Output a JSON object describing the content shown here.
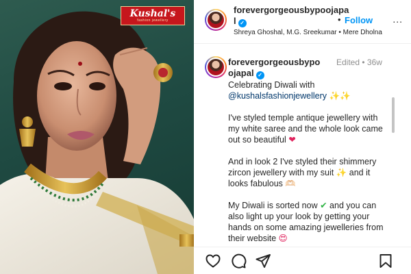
{
  "photo": {
    "brand_name": "Kushal's",
    "brand_tagline": "fashion jewellery"
  },
  "header": {
    "username": "forevergorgeousbypoojapal",
    "verified": true,
    "separator": "•",
    "follow_label": "Follow",
    "more_label": "...",
    "audio": "Shreya Ghoshal, M.G. Sreekumar • Mere Dholna"
  },
  "caption": {
    "username": "forevergorgeousbypoojapal",
    "edited_label": "Edited",
    "separator": "•",
    "age": "36w",
    "line1_text": "Celebrating Diwali with",
    "mention": "@kushalsfashionjewellery",
    "p2_text": "I've styled temple antique jewellery with my white saree and the whole look came out so beautiful",
    "p3_text_a": "And in look 2 I've styled their shimmery zircon jewellery with my suit",
    "p3_text_b": "and it looks fabulous",
    "p3_tail_emoji": "🫶🏻",
    "p4_text_a": "My Diwali is sorted now",
    "p4_text_b": "and you can also light up your look by getting your hands on some amazing jewelleries from their website"
  },
  "emoji": {
    "sparkles": "✨",
    "heart": "❤",
    "check": "✔",
    "heart_eyes": "😍"
  },
  "actions": {
    "icons": [
      "heart-icon",
      "comment-icon",
      "share-icon",
      "bookmark-icon"
    ]
  },
  "colors": {
    "follow_blue": "#0095f6",
    "verified_blue": "#0095f6",
    "mention_blue": "#00376b",
    "brand_red": "#c6161c",
    "photo_bg": "#1f4a42"
  }
}
